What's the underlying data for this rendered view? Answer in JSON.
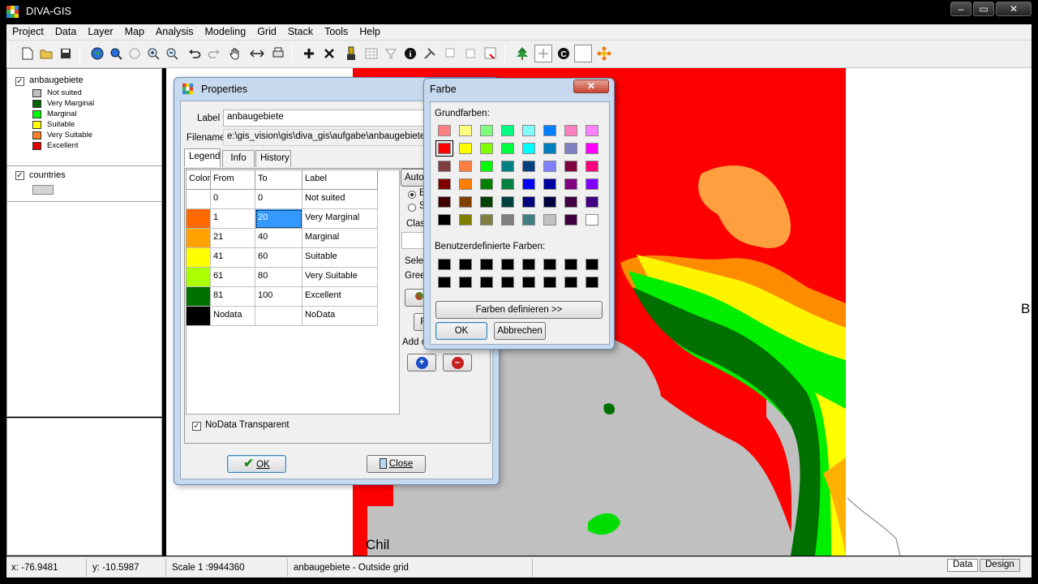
{
  "window": {
    "title": "DIVA-GIS"
  },
  "menu": [
    "Project",
    "Data",
    "Layer",
    "Map",
    "Analysis",
    "Modeling",
    "Grid",
    "Stack",
    "Tools",
    "Help"
  ],
  "toolbar": {
    "buttons": [
      "new-file-icon",
      "open-folder-icon",
      "save-icon",
      "globe-icon",
      "zoom-extent-icon",
      "zoom-previous-icon",
      "zoom-in-icon",
      "zoom-out-icon",
      "undo-icon",
      "redo-icon",
      "pan-hand-icon",
      "measure-icon",
      "print-icon",
      "add-layer-icon",
      "remove-layer-icon",
      "paint-icon",
      "table-icon",
      "filter-icon",
      "info-icon",
      "tools-icon",
      "select-icon",
      "clear-icon",
      "select-record-icon",
      "tree-icon",
      "grid-icon",
      "copyright-icon",
      "blank-icon",
      "flower-icon"
    ]
  },
  "toc": {
    "layers": [
      {
        "name": "anbaugebiete",
        "checked": true,
        "legend": [
          {
            "label": "Not suited",
            "color": "#c0c0c0"
          },
          {
            "label": "Very Marginal",
            "color": "#006400"
          },
          {
            "label": "Marginal",
            "color": "#00ff00"
          },
          {
            "label": "Suitable",
            "color": "#ffff00"
          },
          {
            "label": "Very Suitable",
            "color": "#ff7f27"
          },
          {
            "label": "Excellent",
            "color": "#e00000"
          }
        ]
      },
      {
        "name": "countries",
        "checked": true,
        "swatch": "#d4d4d4"
      }
    ]
  },
  "map": {
    "label_chile": "Chil",
    "label_b": "B"
  },
  "status": {
    "x": "x: -76.9481",
    "y": "y: -10.5987",
    "scale": "Scale 1 :9944360",
    "message": "anbaugebiete - Outside grid",
    "tab_data": "Data",
    "tab_design": "Design"
  },
  "properties": {
    "title": "Properties",
    "label_caption": "Label",
    "label_value": "anbaugebiete",
    "filename_caption": "Filename",
    "filename_value": "e:\\gis_vision\\gis\\diva_gis\\aufgabe\\anbaugebiete.g",
    "tabs": [
      "Legend",
      "Info",
      "History"
    ],
    "columns": [
      "Color",
      "From",
      "To",
      "Label"
    ],
    "rows": [
      {
        "color": "#ffffff",
        "from": "0",
        "to": "0",
        "label": "Not suited"
      },
      {
        "color": "#ff6a00",
        "from": "1",
        "to": "20",
        "label": "Very Marginal",
        "selected_to": true
      },
      {
        "color": "#ffa200",
        "from": "21",
        "to": "40",
        "label": "Marginal"
      },
      {
        "color": "#ffff00",
        "from": "41",
        "to": "60",
        "label": "Suitable"
      },
      {
        "color": "#aaff00",
        "from": "61",
        "to": "80",
        "label": "Very Suitable"
      },
      {
        "color": "#007000",
        "from": "81",
        "to": "100",
        "label": "Excellent"
      },
      {
        "color": "#000000",
        "from": "Nodata",
        "to": "",
        "label": "NoData"
      }
    ],
    "right_panel": {
      "auto_btn": "Auto",
      "radio_a": "E",
      "radio_b": "S",
      "classes_lbl": "Clas",
      "select_lbl": "Selec",
      "green_lbl": "Gree",
      "r_btn": "R",
      "add_lbl": "Add c"
    },
    "nodata_transparent": "NoData Transparent",
    "ok": "OK",
    "close": "Close"
  },
  "farbe": {
    "title": "Farbe",
    "basic_caption": "Grundfarben:",
    "basic_colors": [
      "#ff8080",
      "#ffff80",
      "#80ff80",
      "#00ff80",
      "#80ffff",
      "#0080ff",
      "#ff80c0",
      "#ff80ff",
      "#ff0000",
      "#ffff00",
      "#80ff00",
      "#00ff40",
      "#00ffff",
      "#0080c0",
      "#8080c0",
      "#ff00ff",
      "#804040",
      "#ff8040",
      "#00ff00",
      "#008080",
      "#004080",
      "#8080ff",
      "#800040",
      "#ff0080",
      "#800000",
      "#ff8000",
      "#008000",
      "#008040",
      "#0000ff",
      "#0000a0",
      "#800080",
      "#8000ff",
      "#400000",
      "#804000",
      "#004000",
      "#004040",
      "#000080",
      "#000040",
      "#400040",
      "#400080",
      "#000000",
      "#808000",
      "#808040",
      "#808080",
      "#408080",
      "#c0c0c0",
      "#400040",
      "#ffffff"
    ],
    "selected_index": 8,
    "custom_caption": "Benutzerdefinierte Farben:",
    "custom_colors": [
      "#000000",
      "#000000",
      "#000000",
      "#000000",
      "#000000",
      "#000000",
      "#000000",
      "#000000",
      "#000000",
      "#000000",
      "#000000",
      "#000000",
      "#000000",
      "#000000",
      "#000000",
      "#000000"
    ],
    "define_button": "Farben definieren >>",
    "ok": "OK",
    "cancel": "Abbrechen",
    "close_symbol": "✕"
  }
}
